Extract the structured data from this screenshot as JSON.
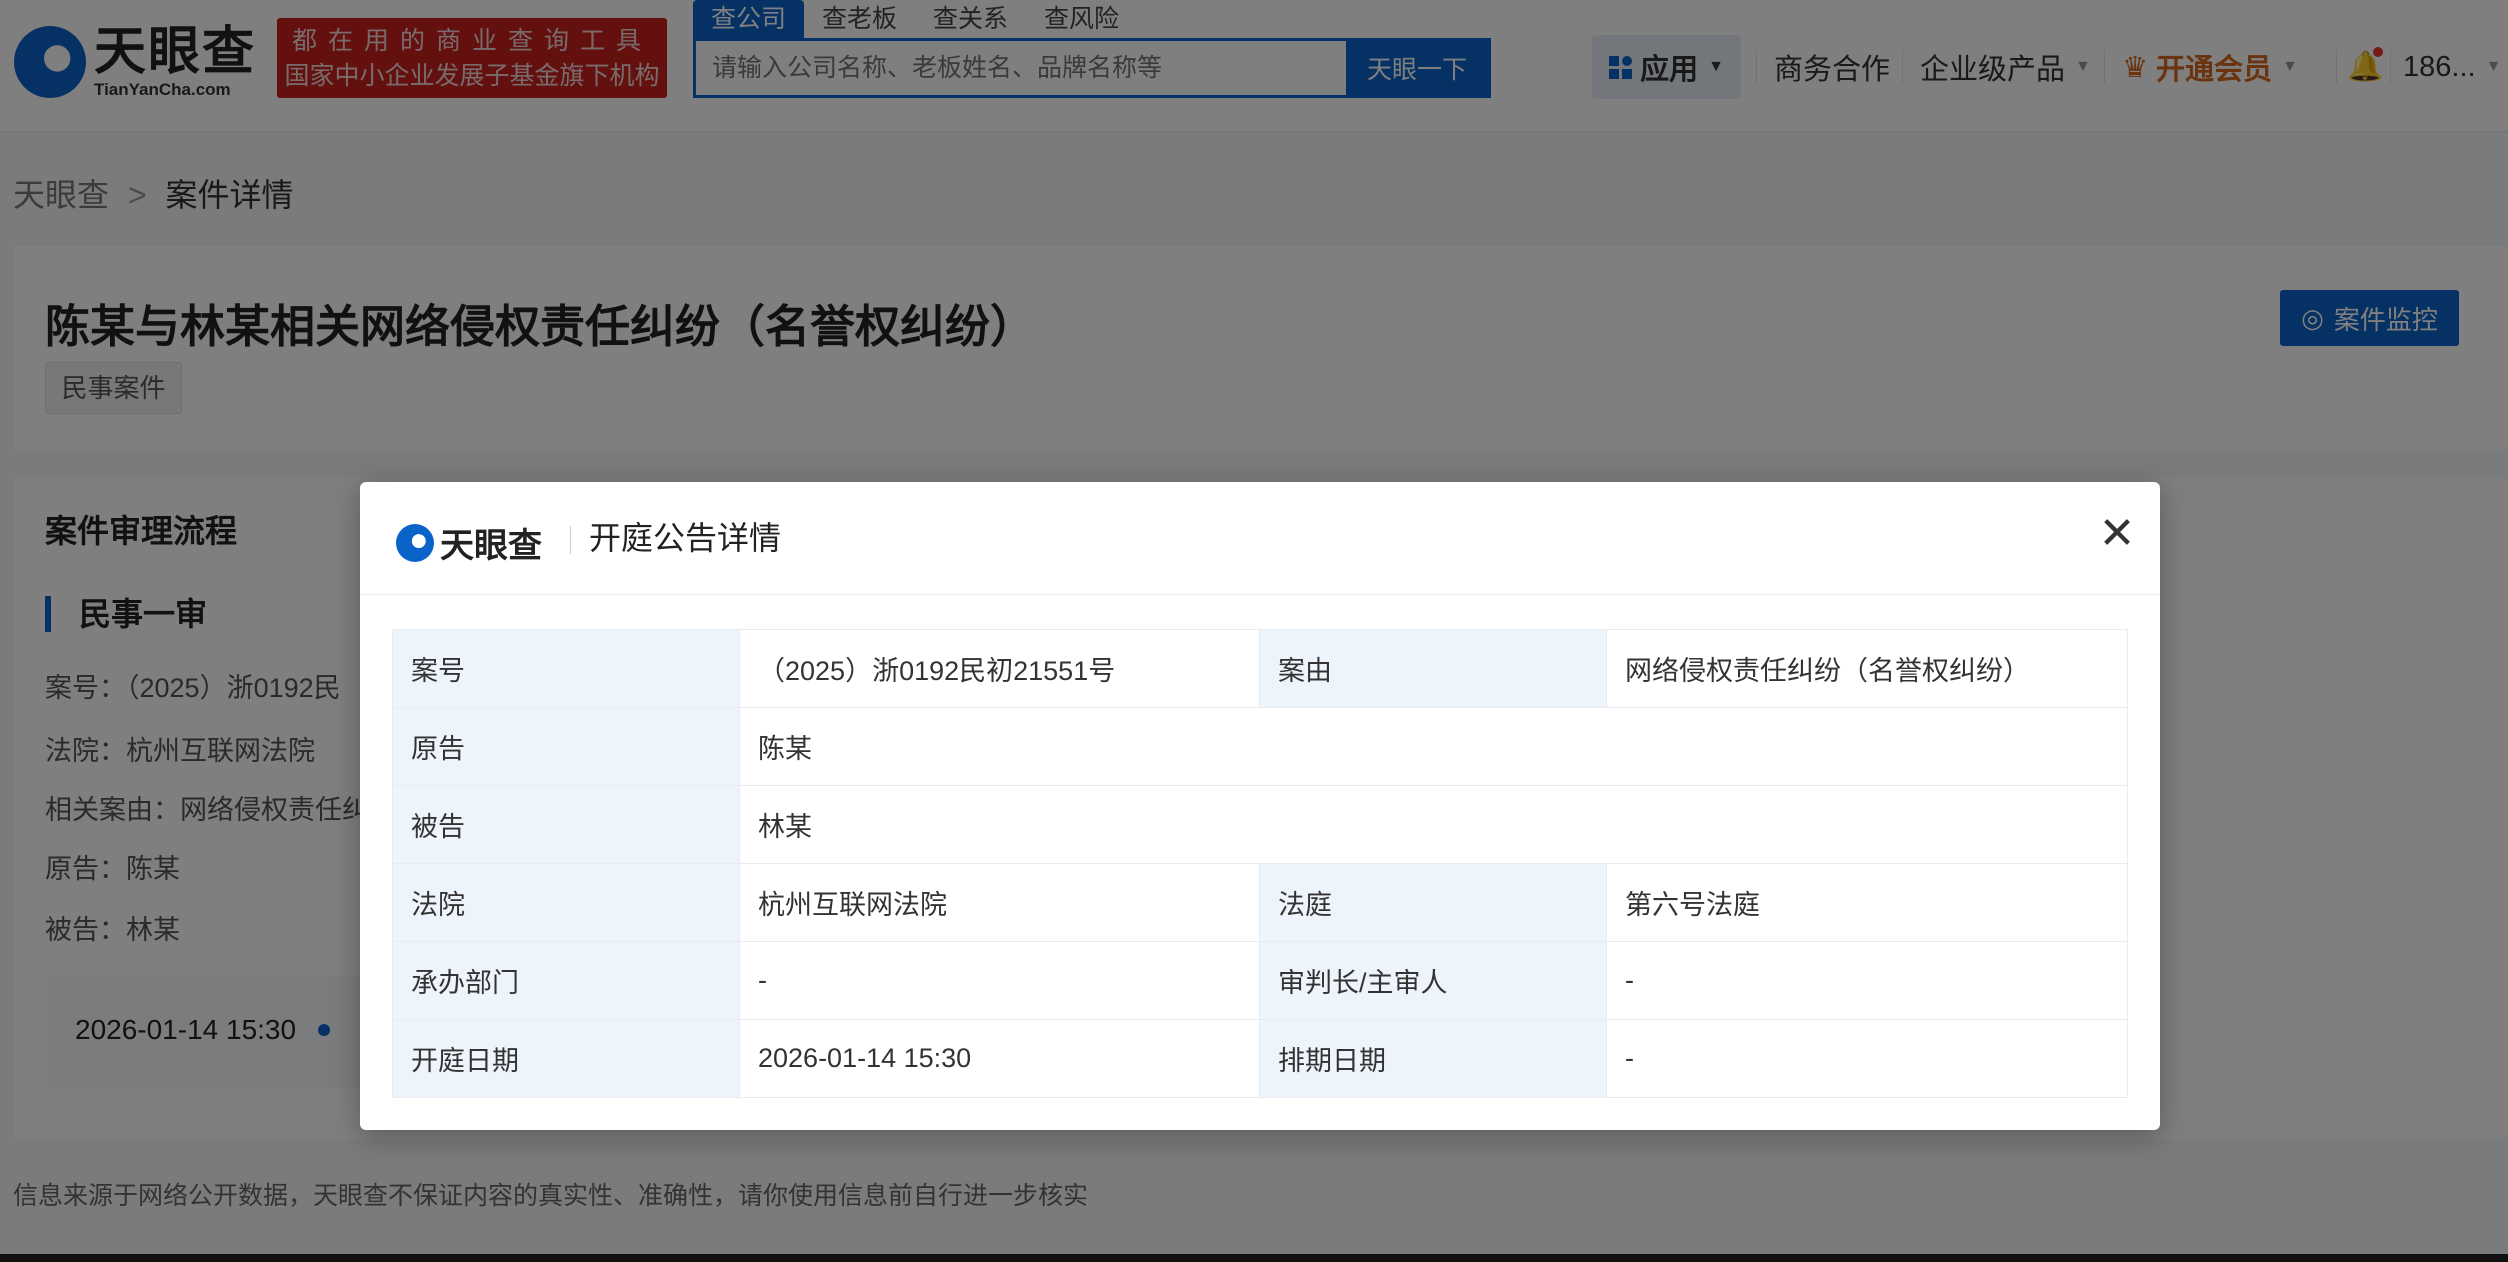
{
  "header": {
    "logo_cn": "天眼查",
    "logo_en": "TianYanCha.com",
    "banner_line1": "都在用的商业查询工具",
    "banner_line2": "国家中小企业发展子基金旗下机构",
    "search_tabs": [
      "查公司",
      "查老板",
      "查关系",
      "查风险"
    ],
    "search_placeholder": "请输入公司名称、老板姓名、品牌名称等",
    "search_button": "天眼一下",
    "nav": {
      "apps": "应用",
      "business": "商务合作",
      "enterprise": "企业级产品",
      "vip": "开通会员",
      "user": "186..."
    }
  },
  "breadcrumb": {
    "home": "天眼查",
    "sep": ">",
    "current": "案件详情"
  },
  "case": {
    "title": "陈某与林某相关网络侵权责任纠纷（名誉权纠纷）",
    "tag": "民事案件",
    "monitor_button": "案件监控"
  },
  "flow": {
    "title": "案件审理流程",
    "stage": "民事一审",
    "lines": [
      "案号：（2025）浙0192民",
      "法院：杭州互联网法院",
      "相关案由：网络侵权责任纠",
      "原告：陈某",
      "被告：林某"
    ],
    "timeline_date": "2026-01-14 15:30"
  },
  "disclaimer": "信息来源于网络公开数据，天眼查不保证内容的真实性、准确性，请你使用信息前自行进一步核实",
  "modal": {
    "logo": "天眼查",
    "title": "开庭公告详情",
    "rows": [
      {
        "l1": "案号",
        "v1": "（2025）浙0192民初21551号",
        "l2": "案由",
        "v2": "网络侵权责任纠纷（名誉权纠纷）"
      },
      {
        "l1": "原告",
        "v1": "陈某"
      },
      {
        "l1": "被告",
        "v1": "林某"
      },
      {
        "l1": "法院",
        "v1": "杭州互联网法院",
        "l2": "法庭",
        "v2": "第六号法庭"
      },
      {
        "l1": "承办部门",
        "v1": "-",
        "l2": "审判长/主审人",
        "v2": "-"
      },
      {
        "l1": "开庭日期",
        "v1": "2026-01-14 15:30",
        "l2": "排期日期",
        "v2": "-"
      }
    ]
  },
  "colors": {
    "brand": "#0a63c9",
    "banner": "#c7211f",
    "vip": "#d2691e"
  }
}
